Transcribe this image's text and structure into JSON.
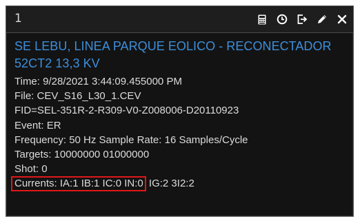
{
  "panel": {
    "number": "1"
  },
  "toolbar": {
    "icons": [
      "calculator-icon",
      "clock-icon",
      "export-icon",
      "pencil-icon",
      "close-icon"
    ]
  },
  "event": {
    "title": "SE LEBU, LINEA PARQUE EOLICO - RECONECTADOR 52CT2 13,3 KV",
    "time": "Time:  9/28/2021 3:44:09.455000 PM",
    "file": "File: CEV_S16_L30_1.CEV",
    "fid": "FID=SEL-351R-2-R309-V0-Z008006-D20110923",
    "event": "Event: ER",
    "frequency": "Frequency: 50 Hz   Sample Rate: 16 Samples/Cycle",
    "targets": "Targets: 10000000 01000000",
    "shot": "Shot: 0",
    "currents_highlighted": "Currents: IA:1 IB:1 IC:0 IN:0",
    "currents_rest": "IG:2 3I2:2"
  },
  "colors": {
    "background": "#131313",
    "title_blue": "#3d8fdc",
    "text": "#dcdcdc",
    "highlight_red": "#e01818"
  }
}
